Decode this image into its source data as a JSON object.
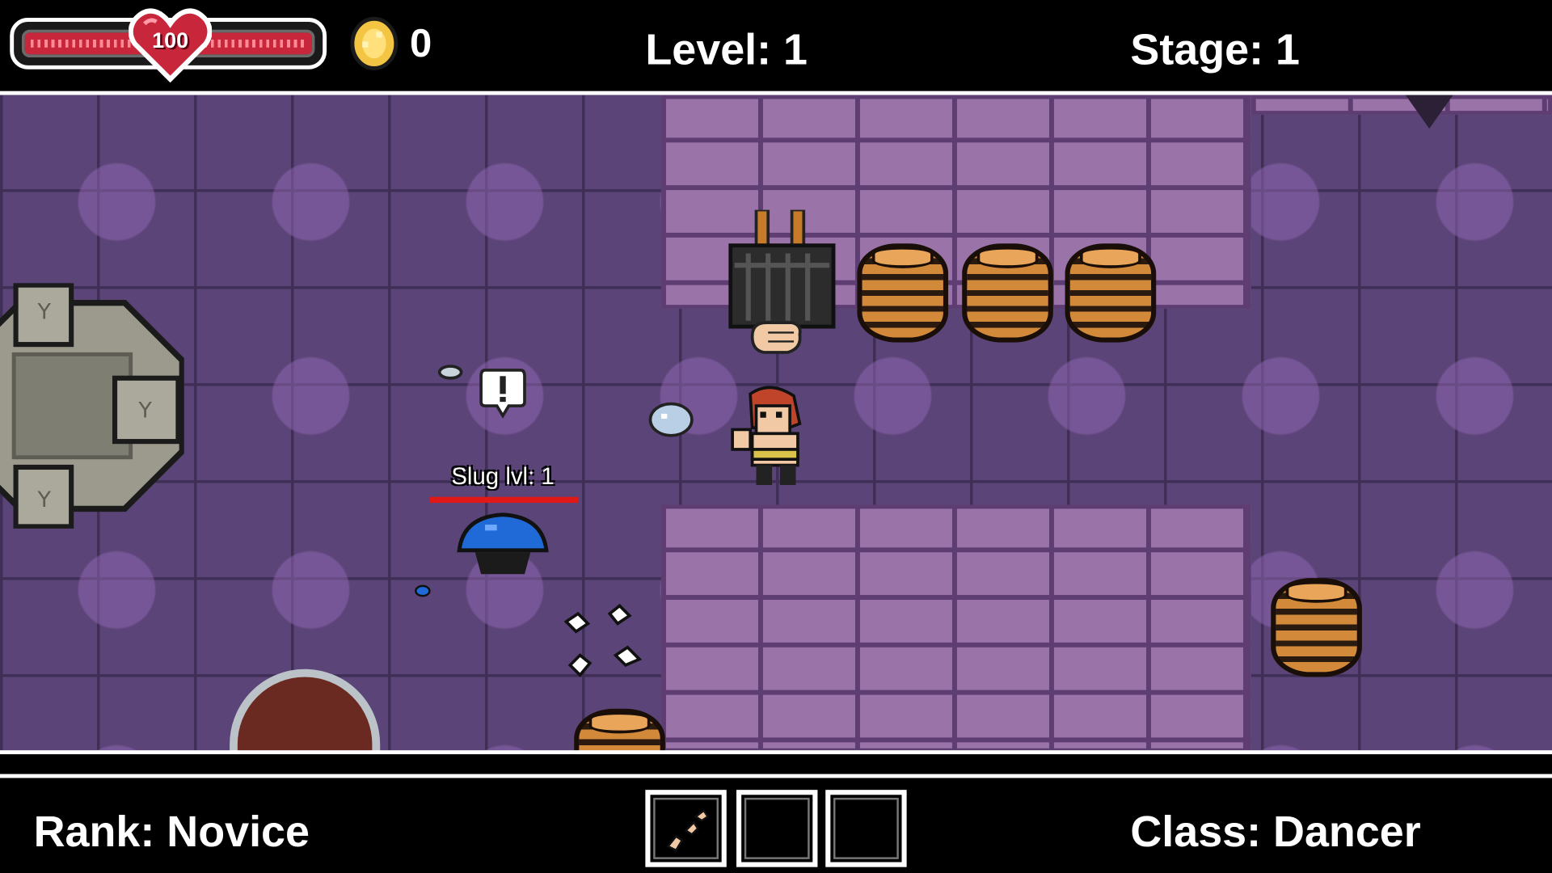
{
  "hud_top": {
    "health": {
      "value": "100",
      "fill_percent": 100
    },
    "coins": "0",
    "level_label": "Level: 1",
    "stage_label": "Stage: 1"
  },
  "field": {
    "enemy": {
      "name": "Slug lvl: 1",
      "health_percent": 100
    }
  },
  "hud_bottom": {
    "rank_label": "Rank: Novice",
    "class_label": "Class: Dancer",
    "slots": [
      {
        "item": "dance-skill-icon"
      },
      {
        "item": ""
      },
      {
        "item": ""
      }
    ]
  },
  "colors": {
    "health_red": "#c8263a",
    "floor_purple": "#5b4478",
    "brick_purple": "#9a73a8",
    "enemy_blue": "#1f6ad6",
    "enemy_hp": "#e01818",
    "coin_gold": "#f4c542"
  }
}
